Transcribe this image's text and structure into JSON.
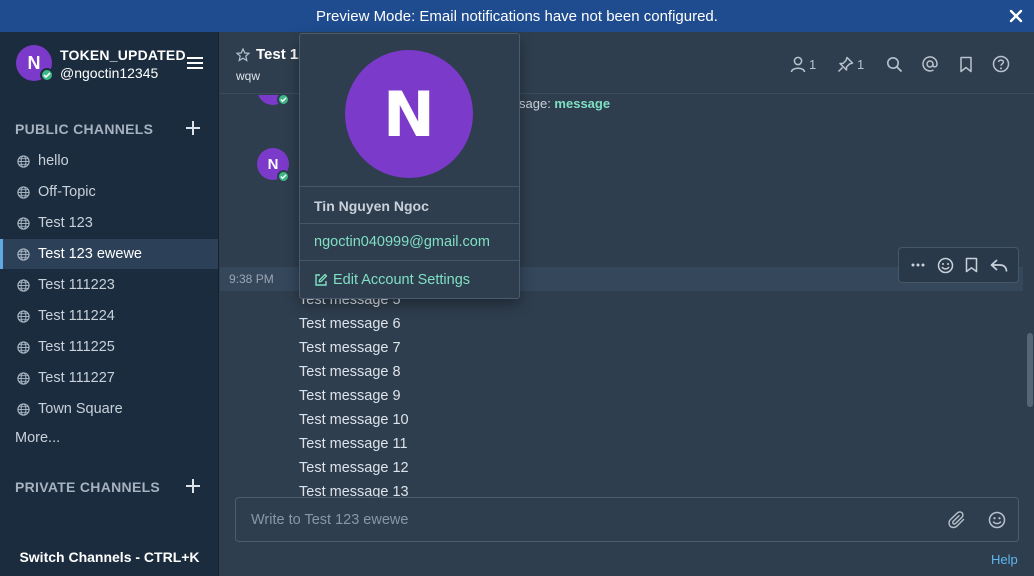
{
  "banner": {
    "text": "Preview Mode: Email notifications have not been configured."
  },
  "team": {
    "avatar_letter": "N",
    "name": "TOKEN_UPDATED",
    "handle": "@ngoctin12345"
  },
  "sidebar": {
    "public_title": "PUBLIC CHANNELS",
    "channels": [
      {
        "label": "hello",
        "active": false
      },
      {
        "label": "Off-Topic",
        "active": false
      },
      {
        "label": "Test 123",
        "active": false
      },
      {
        "label": "Test 123 ewewe",
        "active": true
      },
      {
        "label": "Test 111223",
        "active": false
      },
      {
        "label": "Test 111224",
        "active": false
      },
      {
        "label": "Test 111225",
        "active": false
      },
      {
        "label": "Test 111227",
        "active": false
      },
      {
        "label": "Town Square",
        "active": false
      }
    ],
    "more_label": "More...",
    "private_title": "PRIVATE CHANNELS",
    "switch_label": "Switch Channels - CTRL+K"
  },
  "channel_header": {
    "title": "Test 123 ewewe",
    "purpose": "wqw",
    "member_count": "1",
    "pinned_count": "1"
  },
  "posts": {
    "partial_text_prefix": "sage: ",
    "partial_text_bold": "message",
    "avatar_letter": "N",
    "timestamp": "9:38 PM",
    "messages": [
      "Test message 5",
      "Test message 6",
      "Test message 7",
      "Test message 8",
      "Test message 9",
      "Test message 10",
      "Test message 11",
      "Test message 12",
      "Test message 13"
    ]
  },
  "composer": {
    "placeholder": "Write to Test 123 ewewe"
  },
  "help_label": "Help",
  "profile_popover": {
    "avatar_letter": "N",
    "full_name": "Tin Nguyen Ngoc",
    "email": "ngoctin040999@gmail.com",
    "edit_label": "Edit Account Settings"
  },
  "colors": {
    "banner": "#1e4c8f",
    "sidebar": "#1b2c3e",
    "center": "#2f3e4e",
    "avatar": "#7b3ac9",
    "accent_link": "#7fe0c4",
    "online": "#3db887"
  }
}
